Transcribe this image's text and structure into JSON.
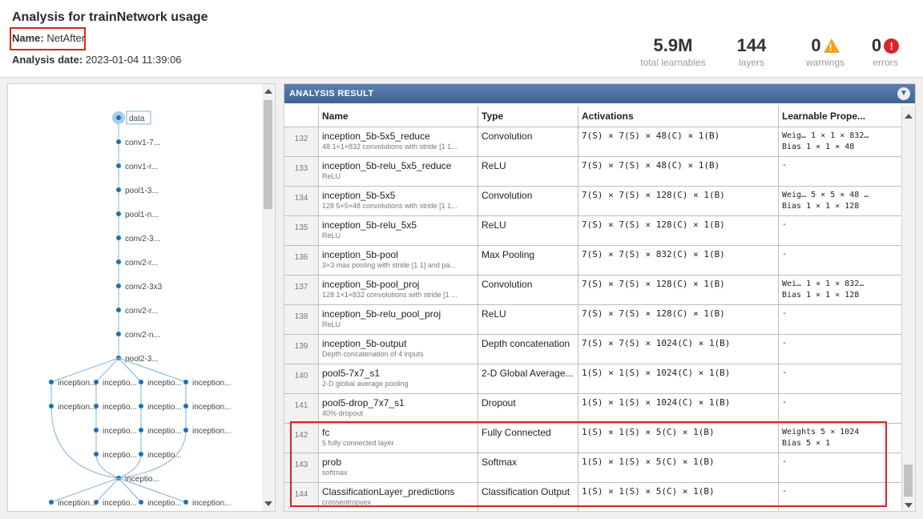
{
  "header": {
    "title": "Analysis for trainNetwork usage",
    "name_label": "Name:",
    "name_value": "NetAfter",
    "date_label": "Analysis date:",
    "date_value": "2023-01-04 11:39:06"
  },
  "stats": [
    {
      "value": "5.9M",
      "label": "total learnables"
    },
    {
      "value": "144",
      "label": "layers"
    },
    {
      "value": "0",
      "label": "warnings",
      "icon": "warning-icon"
    },
    {
      "value": "0",
      "label": "errors",
      "icon": "error-icon"
    }
  ],
  "graph": {
    "nodes": [
      "data",
      "conv1-7...",
      "conv1-r...",
      "pool1-3...",
      "pool1-n...",
      "conv2-3...",
      "conv2-r...",
      "conv2-3x3",
      "conv2-r...",
      "conv2-n...",
      "pool2-3...",
      "inception...",
      "inceptio...",
      "inceptio...",
      "inception..."
    ]
  },
  "result": {
    "title": "ANALYSIS RESULT",
    "columns": [
      "Name",
      "Type",
      "Activations",
      "Learnable Prope..."
    ],
    "rows": [
      {
        "idx": "132",
        "name": "inception_5b-5x5_reduce",
        "desc": "48 1×1×832 convolutions with stride [1 1...",
        "type": "Convolution",
        "act": "7(S) × 7(S) × 48(C) × 1(B)",
        "learn1": "Weig… 1 × 1 × 832…",
        "learn2": "Bias  1 × 1 × 48"
      },
      {
        "idx": "133",
        "name": "inception_5b-relu_5x5_reduce",
        "desc": "ReLU",
        "type": "ReLU",
        "act": "7(S) × 7(S) × 48(C) × 1(B)",
        "learn1": "-",
        "learn2": ""
      },
      {
        "idx": "134",
        "name": "inception_5b-5x5",
        "desc": "128 5×5×48 convolutions with stride [1 1...",
        "type": "Convolution",
        "act": "7(S) × 7(S) × 128(C) × 1(B)",
        "learn1": "Weig… 5 × 5 × 48 …",
        "learn2": "Bias  1 × 1 × 128"
      },
      {
        "idx": "135",
        "name": "inception_5b-relu_5x5",
        "desc": "ReLU",
        "type": "ReLU",
        "act": "7(S) × 7(S) × 128(C) × 1(B)",
        "learn1": "-",
        "learn2": ""
      },
      {
        "idx": "136",
        "name": "inception_5b-pool",
        "desc": "3×3 max pooling with stride [1 1] and pa...",
        "type": "Max Pooling",
        "act": "7(S) × 7(S) × 832(C) × 1(B)",
        "learn1": "-",
        "learn2": ""
      },
      {
        "idx": "137",
        "name": "inception_5b-pool_proj",
        "desc": "128 1×1×832 convolutions with stride [1 ...",
        "type": "Convolution",
        "act": "7(S) × 7(S) × 128(C) × 1(B)",
        "learn1": "Wei…  1 × 1 × 832…",
        "learn2": "Bias  1 × 1 × 128"
      },
      {
        "idx": "138",
        "name": "inception_5b-relu_pool_proj",
        "desc": "ReLU",
        "type": "ReLU",
        "act": "7(S) × 7(S) × 128(C) × 1(B)",
        "learn1": "-",
        "learn2": ""
      },
      {
        "idx": "139",
        "name": "inception_5b-output",
        "desc": "Depth concatenation of 4 inputs",
        "type": "Depth concatenation",
        "act": "7(S) × 7(S) × 1024(C) × 1(B)",
        "learn1": "-",
        "learn2": ""
      },
      {
        "idx": "140",
        "name": "pool5-7x7_s1",
        "desc": "2-D global average pooling",
        "type": "2-D Global Average...",
        "act": "1(S) × 1(S) × 1024(C) × 1(B)",
        "learn1": "-",
        "learn2": ""
      },
      {
        "idx": "141",
        "name": "pool5-drop_7x7_s1",
        "desc": "40% dropout",
        "type": "Dropout",
        "act": "1(S) × 1(S) × 1024(C) × 1(B)",
        "learn1": "-",
        "learn2": ""
      },
      {
        "idx": "142",
        "name": "fc",
        "desc": "5 fully connected layer",
        "type": "Fully Connected",
        "act": "1(S) × 1(S) × 5(C) × 1(B)",
        "learn1": "Weights  5 × 1024",
        "learn2": "Bias     5 × 1"
      },
      {
        "idx": "143",
        "name": "prob",
        "desc": "softmax",
        "type": "Softmax",
        "act": "1(S) × 1(S) × 5(C) × 1(B)",
        "learn1": "-",
        "learn2": ""
      },
      {
        "idx": "144",
        "name": "ClassificationLayer_predictions",
        "desc": "crossentropyex",
        "type": "Classification Output",
        "act": "1(S) × 1(S) × 5(C) × 1(B)",
        "learn1": "-",
        "learn2": ""
      }
    ]
  },
  "colors": {
    "accent": "#3f6396",
    "highlight": "#e0231c",
    "node": "#1f6fb5"
  }
}
